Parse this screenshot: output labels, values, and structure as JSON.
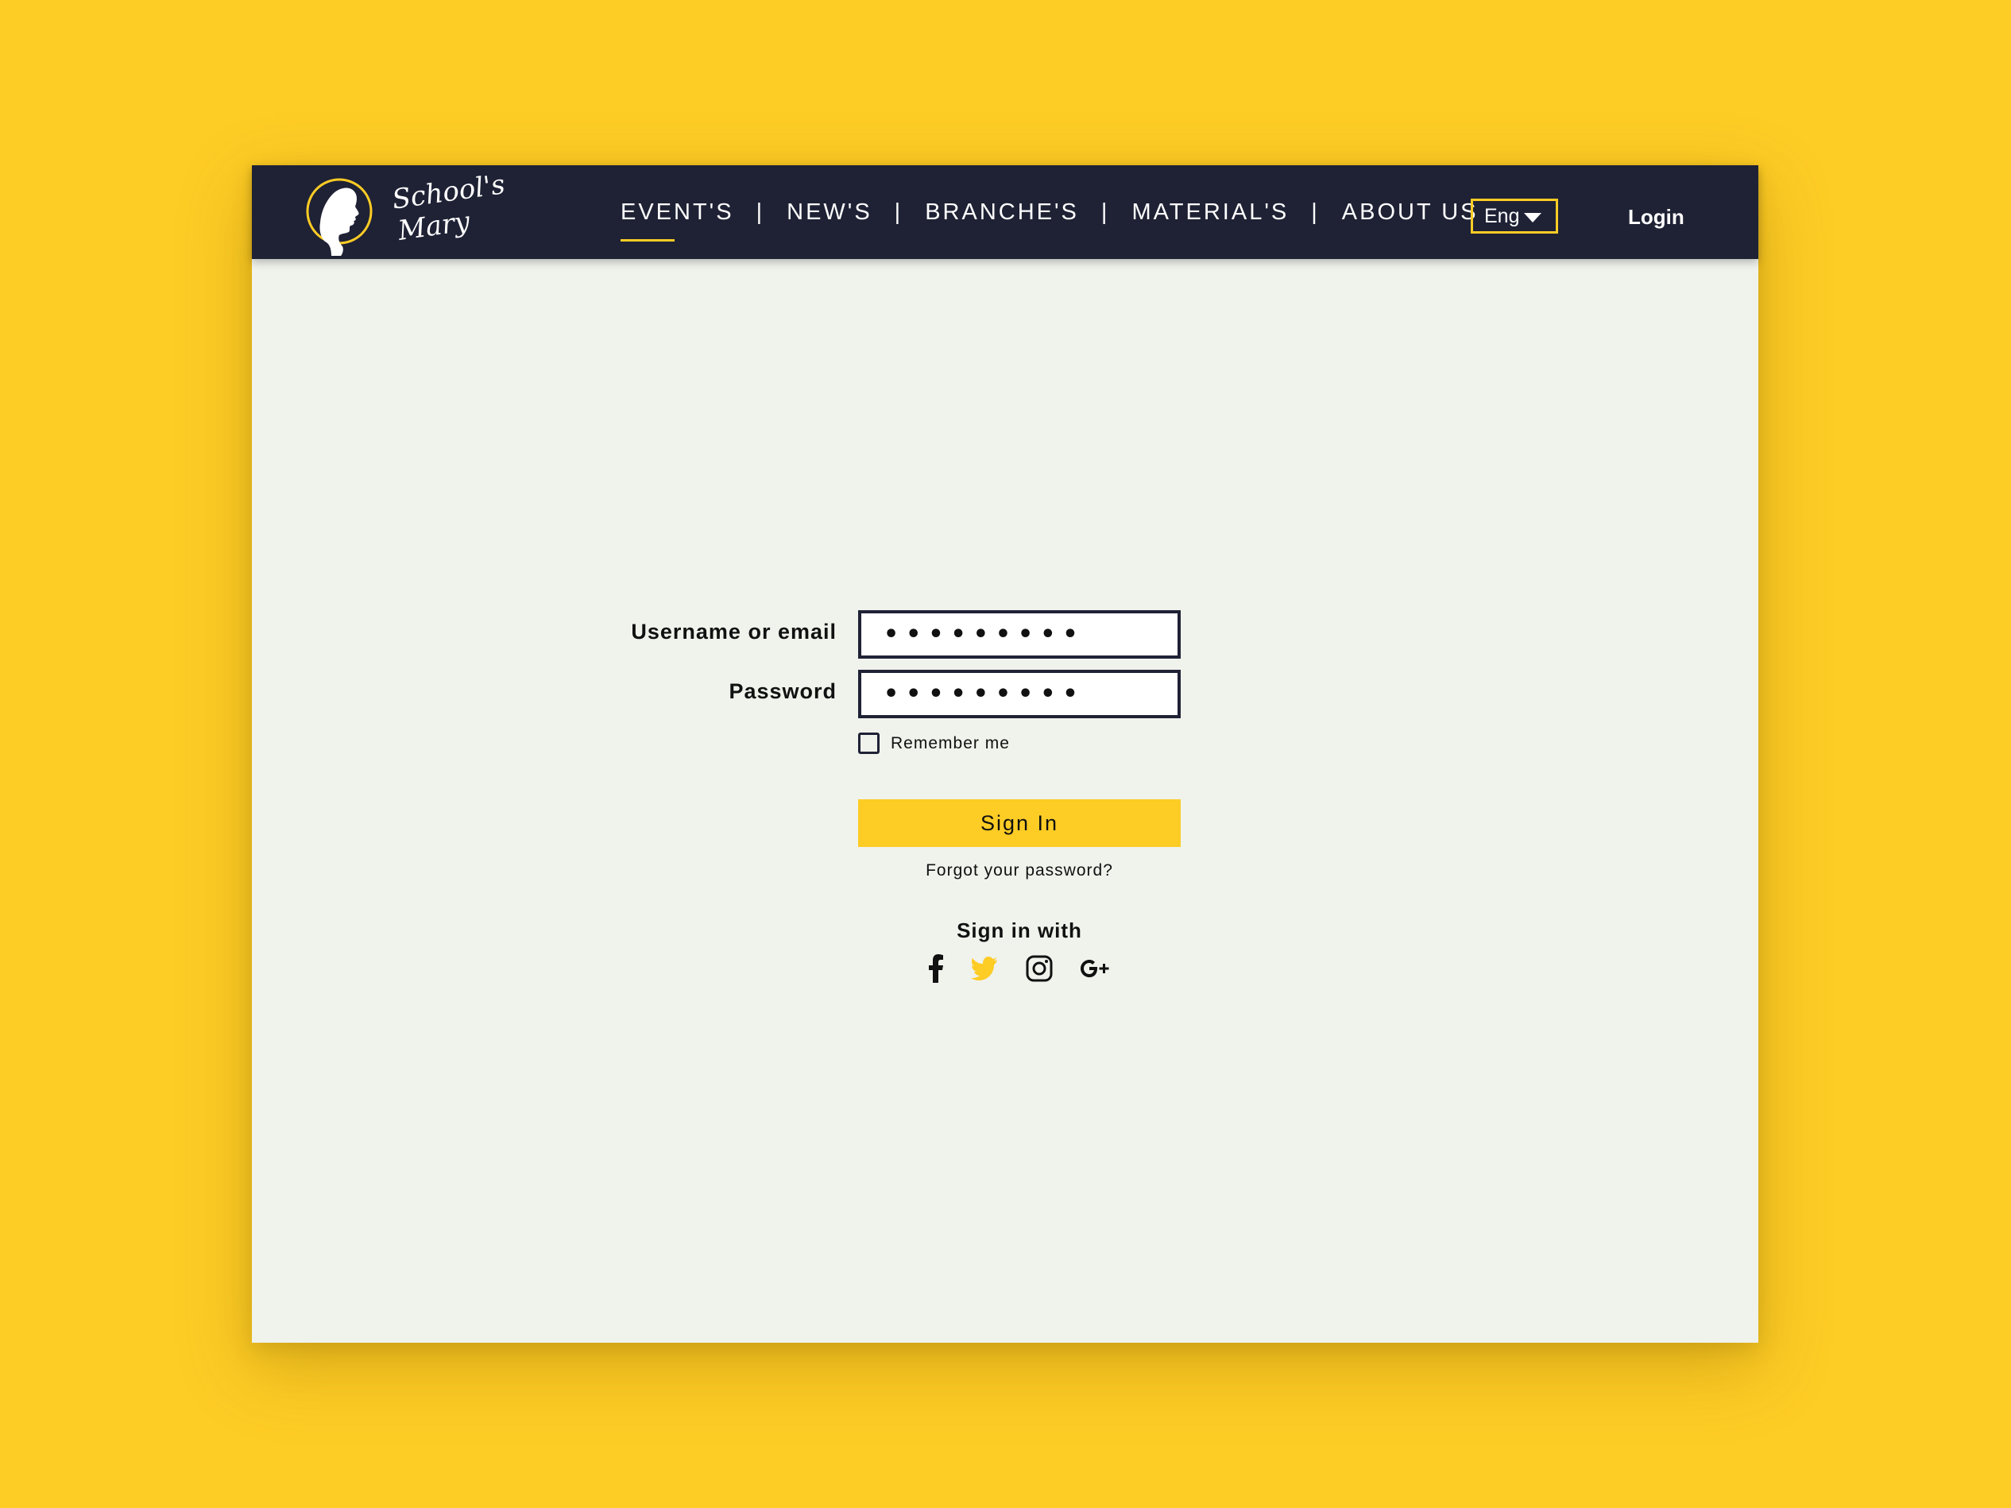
{
  "brand": {
    "line1": "School's",
    "line2": "Mary",
    "accent_color": "#FDCC25",
    "navbar_color": "#1F2235",
    "logo_icon": "silhouette-profile-icon"
  },
  "nav": {
    "items": [
      {
        "label": "EVENT'S",
        "active": true
      },
      {
        "label": "NEW'S"
      },
      {
        "label": "BRANCHE'S"
      },
      {
        "label": "MATERIAL'S"
      },
      {
        "label": "ABOUT US"
      }
    ],
    "separator": "|",
    "language": "Eng",
    "login_label": "Login"
  },
  "form": {
    "username_label": "Username or email",
    "username_value": "•••••••••",
    "password_label": "Password",
    "password_value": "•••••••••",
    "remember_label": "Remember me",
    "remember_checked": false,
    "signin_label": "Sign In",
    "forgot_label": "Forgot your password?",
    "signin_with_label": "Sign in with"
  },
  "social": [
    {
      "icon": "facebook-icon"
    },
    {
      "icon": "twitter-icon",
      "color": "#FDCC25"
    },
    {
      "icon": "instagram-icon"
    },
    {
      "icon": "google-plus-icon"
    }
  ]
}
